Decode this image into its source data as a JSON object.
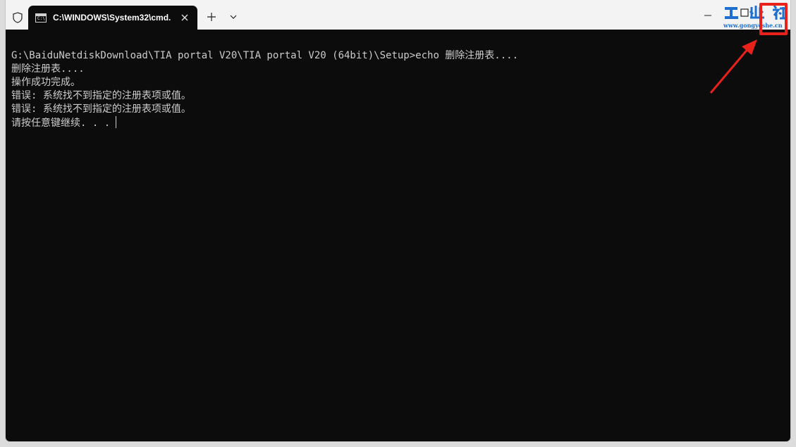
{
  "window": {
    "tab_title": "C:\\WINDOWS\\System32\\cmd.",
    "tab_icon_text": "C:\\"
  },
  "titlebar": {
    "new_tab_label": "+",
    "icons": [
      "shield-icon",
      "cmd-icon",
      "close-icon",
      "plus-icon",
      "chevron-down-icon",
      "minimize-icon"
    ]
  },
  "watermark": {
    "url": "www.gongyeshe.cn",
    "brand_color": "#1f6fd1",
    "highlight_color": "#e8221b"
  },
  "terminal": {
    "lines": [
      "G:\\BaiduNetdiskDownload\\TIA portal V20\\TIA portal V20 (64bit)\\Setup>echo 删除注册表....",
      "删除注册表....",
      "操作成功完成。",
      "错误: 系统找不到指定的注册表项或值。",
      "错误: 系统找不到指定的注册表项或值。",
      "请按任意键继续. . ."
    ],
    "foreground": "#cccccc",
    "background": "#0c0c0c"
  }
}
